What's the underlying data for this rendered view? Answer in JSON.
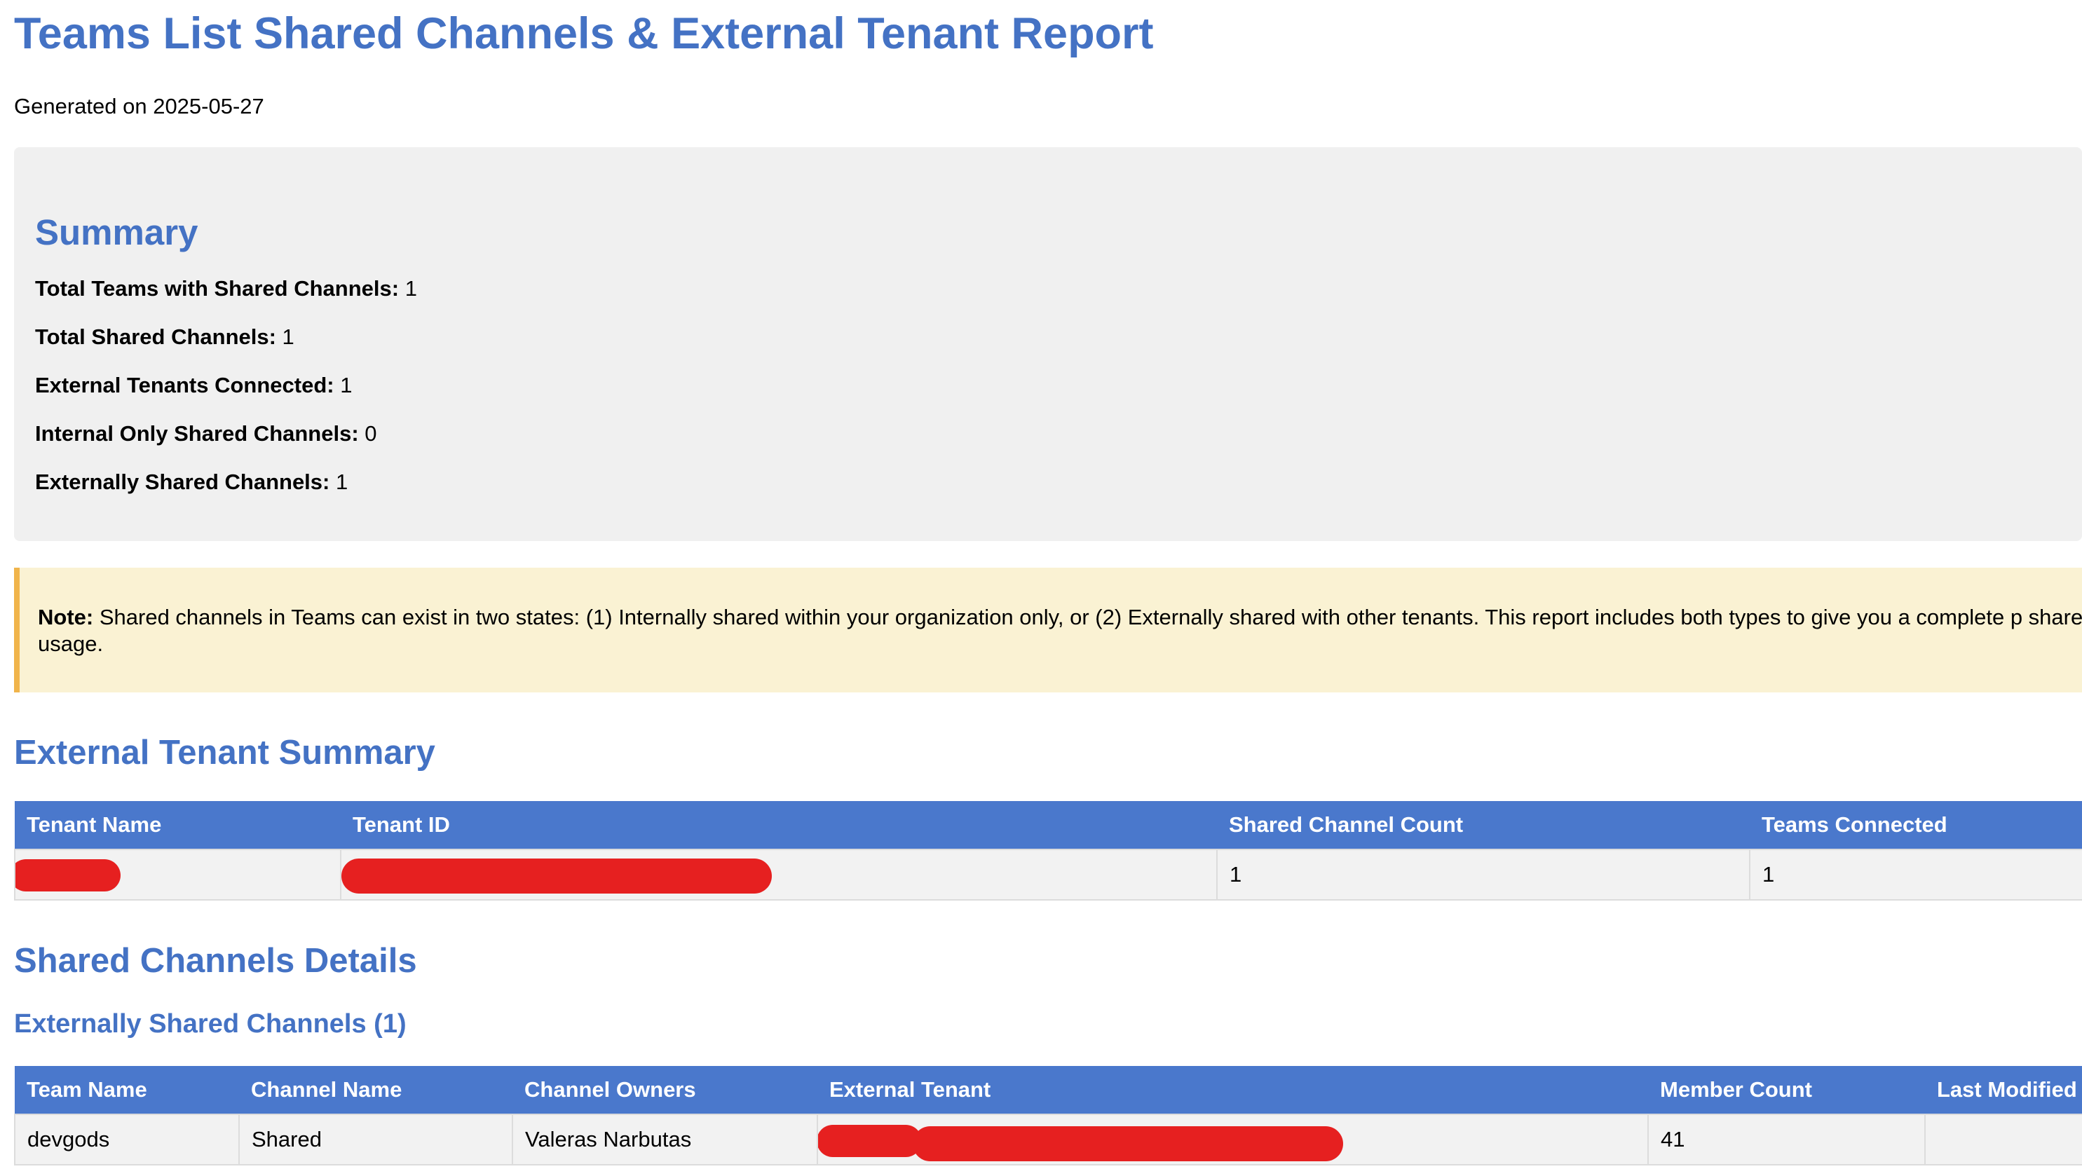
{
  "report": {
    "title": "Teams List Shared Channels & External Tenant Report",
    "generated": "Generated on 2025-05-27"
  },
  "summary": {
    "heading": "Summary",
    "items": [
      {
        "label": "Total Teams with Shared Channels:",
        "value": "1"
      },
      {
        "label": "Total Shared Channels:",
        "value": "1"
      },
      {
        "label": "External Tenants Connected:",
        "value": "1"
      },
      {
        "label": "Internal Only Shared Channels:",
        "value": "0"
      },
      {
        "label": "Externally Shared Channels:",
        "value": "1"
      }
    ]
  },
  "note": {
    "label": "Note:",
    "text": "Shared channels in Teams can exist in two states: (1) Internally shared within your organization only, or (2) Externally shared with other tenants. This report includes both types to give you a complete p shared channel usage."
  },
  "tenant_summary": {
    "heading": "External Tenant Summary",
    "columns": [
      "Tenant Name",
      "Tenant ID",
      "Shared Channel Count",
      "Teams Connected"
    ],
    "rows": [
      {
        "tenant_name": "",
        "tenant_id": "",
        "shared_channel_count": "1",
        "teams_connected": "1"
      }
    ]
  },
  "channel_details": {
    "heading": "Shared Channels Details",
    "subheading": "Externally Shared Channels (1)",
    "columns": [
      "Team Name",
      "Channel Name",
      "Channel Owners",
      "External Tenant",
      "Member Count",
      "Last Modified"
    ],
    "rows": [
      {
        "team_name": "devgods",
        "channel_name": "Shared",
        "channel_owners": "Valeras Narbutas",
        "external_tenant": "",
        "member_count": "41",
        "last_modified": ""
      }
    ]
  },
  "colors": {
    "heading": "#4472c4",
    "table_header": "#4a78cc",
    "summary_bg": "#f0f0f0",
    "note_bg": "#faf2d3",
    "note_border": "#f0b44b",
    "redaction": "#e62020"
  }
}
